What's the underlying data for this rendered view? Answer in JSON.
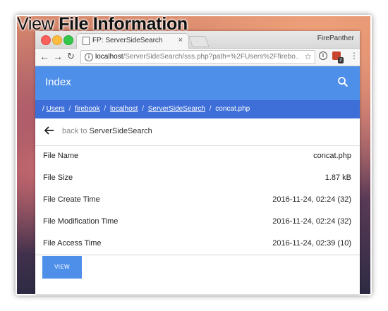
{
  "caption": {
    "light": "View",
    "bold": "File Information"
  },
  "browser": {
    "tab_title": "FP: ServerSideSearch",
    "tab_close": "×",
    "profile_name": "FirePanther",
    "url_host": "localhost",
    "url_path": "/ServerSideSearch/sss.php?path=%2FUsers%2Ffirebo...",
    "extension_badge": "2"
  },
  "app": {
    "title": "Index",
    "accent_color": "#4e8fea",
    "breadcrumb_color": "#3e6fd8"
  },
  "breadcrumbs": {
    "root": "/",
    "items": [
      "Users",
      "firebook",
      "localhost",
      "ServerSideSearch"
    ],
    "current": "concat.php"
  },
  "back": {
    "prefix": "back to",
    "target": "ServerSideSearch"
  },
  "file_info": [
    {
      "label": "File Name",
      "value": "concat.php"
    },
    {
      "label": "File Size",
      "value": "1.87 kB"
    },
    {
      "label": "File Create Time",
      "value": "2016-11-24, 02:24 (32)"
    },
    {
      "label": "File Modification Time",
      "value": "2016-11-24, 02:24 (32)"
    },
    {
      "label": "File Access Time",
      "value": "2016-11-24, 02:39 (10)"
    }
  ],
  "view_button": "VIEW"
}
